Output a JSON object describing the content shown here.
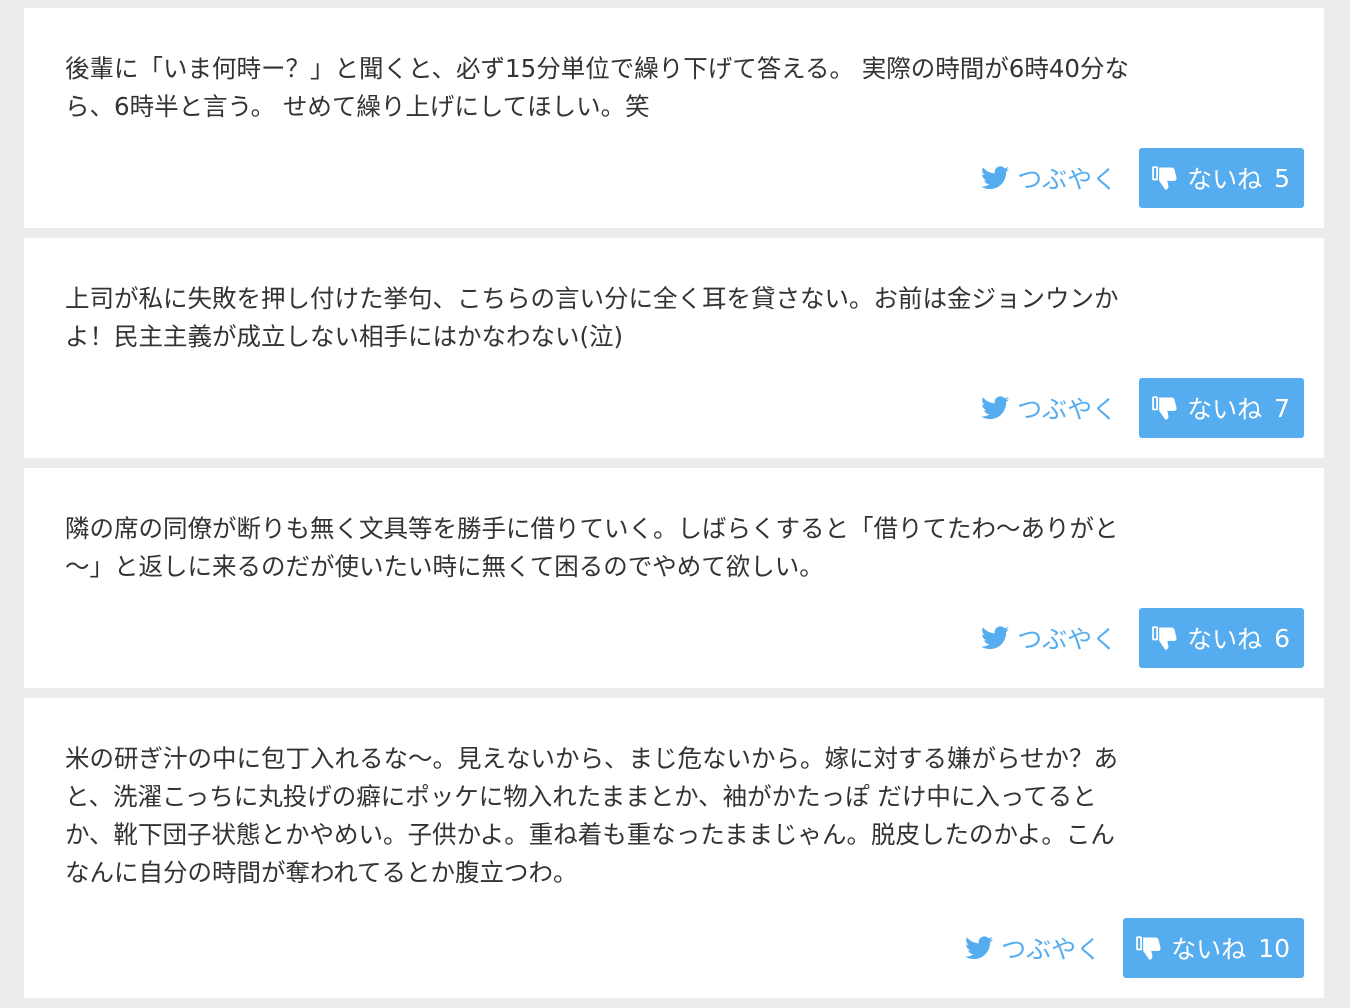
{
  "posts": [
    {
      "text": "後輩に「いま何時ー？」と聞くと、必ず15分単位で繰り下げて答える。 実際の時間が6時40分な\nら、6時半と言う。 せめて繰り上げにしてほしい。笑",
      "tweet_label": "つぶやく",
      "dislike_label": "ないね",
      "dislike_count": "5"
    },
    {
      "text": "上司が私に失敗を押し付けた挙句、こちらの言い分に全く耳を貸さない。お前は金ジョンウンか\nよ！民主主義が成立しない相手にはかなわない(泣)",
      "tweet_label": "つぶやく",
      "dislike_label": "ないね",
      "dislike_count": "7"
    },
    {
      "text": "隣の席の同僚が断りも無く文具等を勝手に借りていく。しばらくすると「借りてたわ〜ありがと\n〜」と返しに来るのだが使いたい時に無くて困るのでやめて欲しい。",
      "tweet_label": "つぶやく",
      "dislike_label": "ないね",
      "dislike_count": "6"
    },
    {
      "text": "米の研ぎ汁の中に包丁入れるな〜。見えないから、まじ危ないから。嫁に対する嫌がらせか？あ\nと、洗濯こっちに丸投げの癖にポッケに物入れたままとか、袖がかたっぽ だけ中に入ってると\nか、靴下団子状態とかやめい。子供かよ。重ね着も重なったままじゃん。脱皮したのかよ。こん\nなんに自分の時間が奪われてるとか腹立つわ。",
      "tweet_label": "つぶやく",
      "dislike_label": "ないね",
      "dislike_count": "10"
    }
  ],
  "colors": {
    "accent": "#55acee",
    "background": "#ececec",
    "card": "#ffffff",
    "text": "#333333"
  },
  "icons": {
    "tweet": "twitter-bird-icon",
    "dislike": "thumbs-down-icon"
  }
}
